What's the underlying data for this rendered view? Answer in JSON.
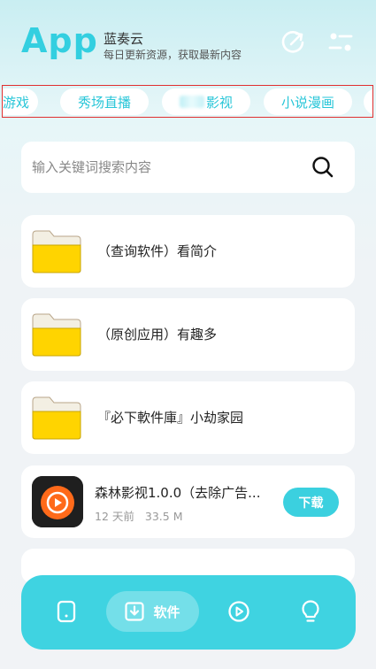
{
  "header": {
    "logo": "App",
    "name": "蓝奏云",
    "subtitle": "每日更新资源，获取最新内容",
    "refresh_icon": "refresh-icon",
    "filter_icon": "filter-icon"
  },
  "tabs": [
    {
      "label": "游戏"
    },
    {
      "label": "秀场直播"
    },
    {
      "label": "影视"
    },
    {
      "label": "小说漫画"
    },
    {
      "label": ""
    }
  ],
  "search": {
    "placeholder": "输入关键词搜索内容",
    "icon": "search-icon"
  },
  "items": [
    {
      "type": "folder",
      "title": "（查询软件）看简介"
    },
    {
      "type": "folder",
      "title": "（原创应用）有趣多"
    },
    {
      "type": "folder",
      "title": "『必下軟件庫』小劫家园"
    },
    {
      "type": "app",
      "title": "森林影视1.0.0（去除广告...",
      "age": "12 天前",
      "size": "33.5 M",
      "action": "下载"
    }
  ],
  "bottom_nav": {
    "items": [
      {
        "icon": "phone-icon",
        "label": ""
      },
      {
        "icon": "download-box-icon",
        "label": "软件",
        "active": true
      },
      {
        "icon": "play-circle-icon",
        "label": ""
      },
      {
        "icon": "lightbulb-icon",
        "label": ""
      }
    ]
  },
  "colors": {
    "accent": "#3bd0df",
    "folder": "#ffd400",
    "tab_border": "#e03030"
  }
}
